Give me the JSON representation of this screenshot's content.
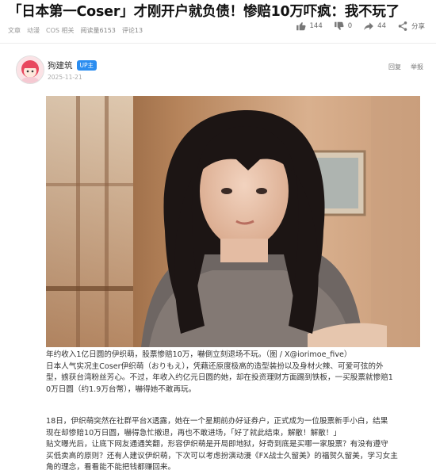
{
  "article": {
    "title": "「日本第一Coser」才刚开户就负债！惨赔10万吓疯：我不玩了",
    "meta": {
      "tag1": "文章",
      "tag2": "动漫",
      "tag3": "COS 相关",
      "reads": "阅读量6153",
      "comments": "评论13"
    },
    "actions": {
      "likes": "144",
      "dislikes": "0",
      "shares_count": "44",
      "share_label": "分享"
    }
  },
  "author": {
    "name": "狗建筑",
    "badge": "UP主",
    "date": "2025-11-21",
    "follow": "回复",
    "report": "举报"
  },
  "content": {
    "para1": [
      "年约收入1亿日圆的伊织萌，股票惨赔10万，嚇倒立刻退场不玩。（图 / X@iorimoe_five）",
      "日本人气实况主Coser伊织萌（おりもえ），凭藉还原度极高的造型装扮以及身材火辣、可爱可弦的外",
      "型，掳获台湾粉丝芳心。不过，年收入约亿元日圆的她，却在投资理财方面踢到铁板，一买股票就惨赔1",
      "0万日圆（约1.9万台幣），嚇得她不敢再玩。"
    ],
    "para2": [
      "18日，伊织萌突然在社群平台X透露，她在一个星期前办好证券户，正式成为一位股票新手小白，结果",
      "现在却惨赔10万日圆，嚇得急忙撤退，再也不敢进场，「好了就此结束，解散！解散！」",
      "贴文曝光后，让底下网友通通笑翻，形容伊织萌是开局即地狱，好奇到底是买哪一家股票？有没有遵守",
      "买低卖高的原则？还有人建议伊织萌，下次可以考虑扮演动漫《FX战士久留美》的福贺久留美，学习女主",
      "角的理念，看看能不能把钱都赚回来。"
    ]
  }
}
